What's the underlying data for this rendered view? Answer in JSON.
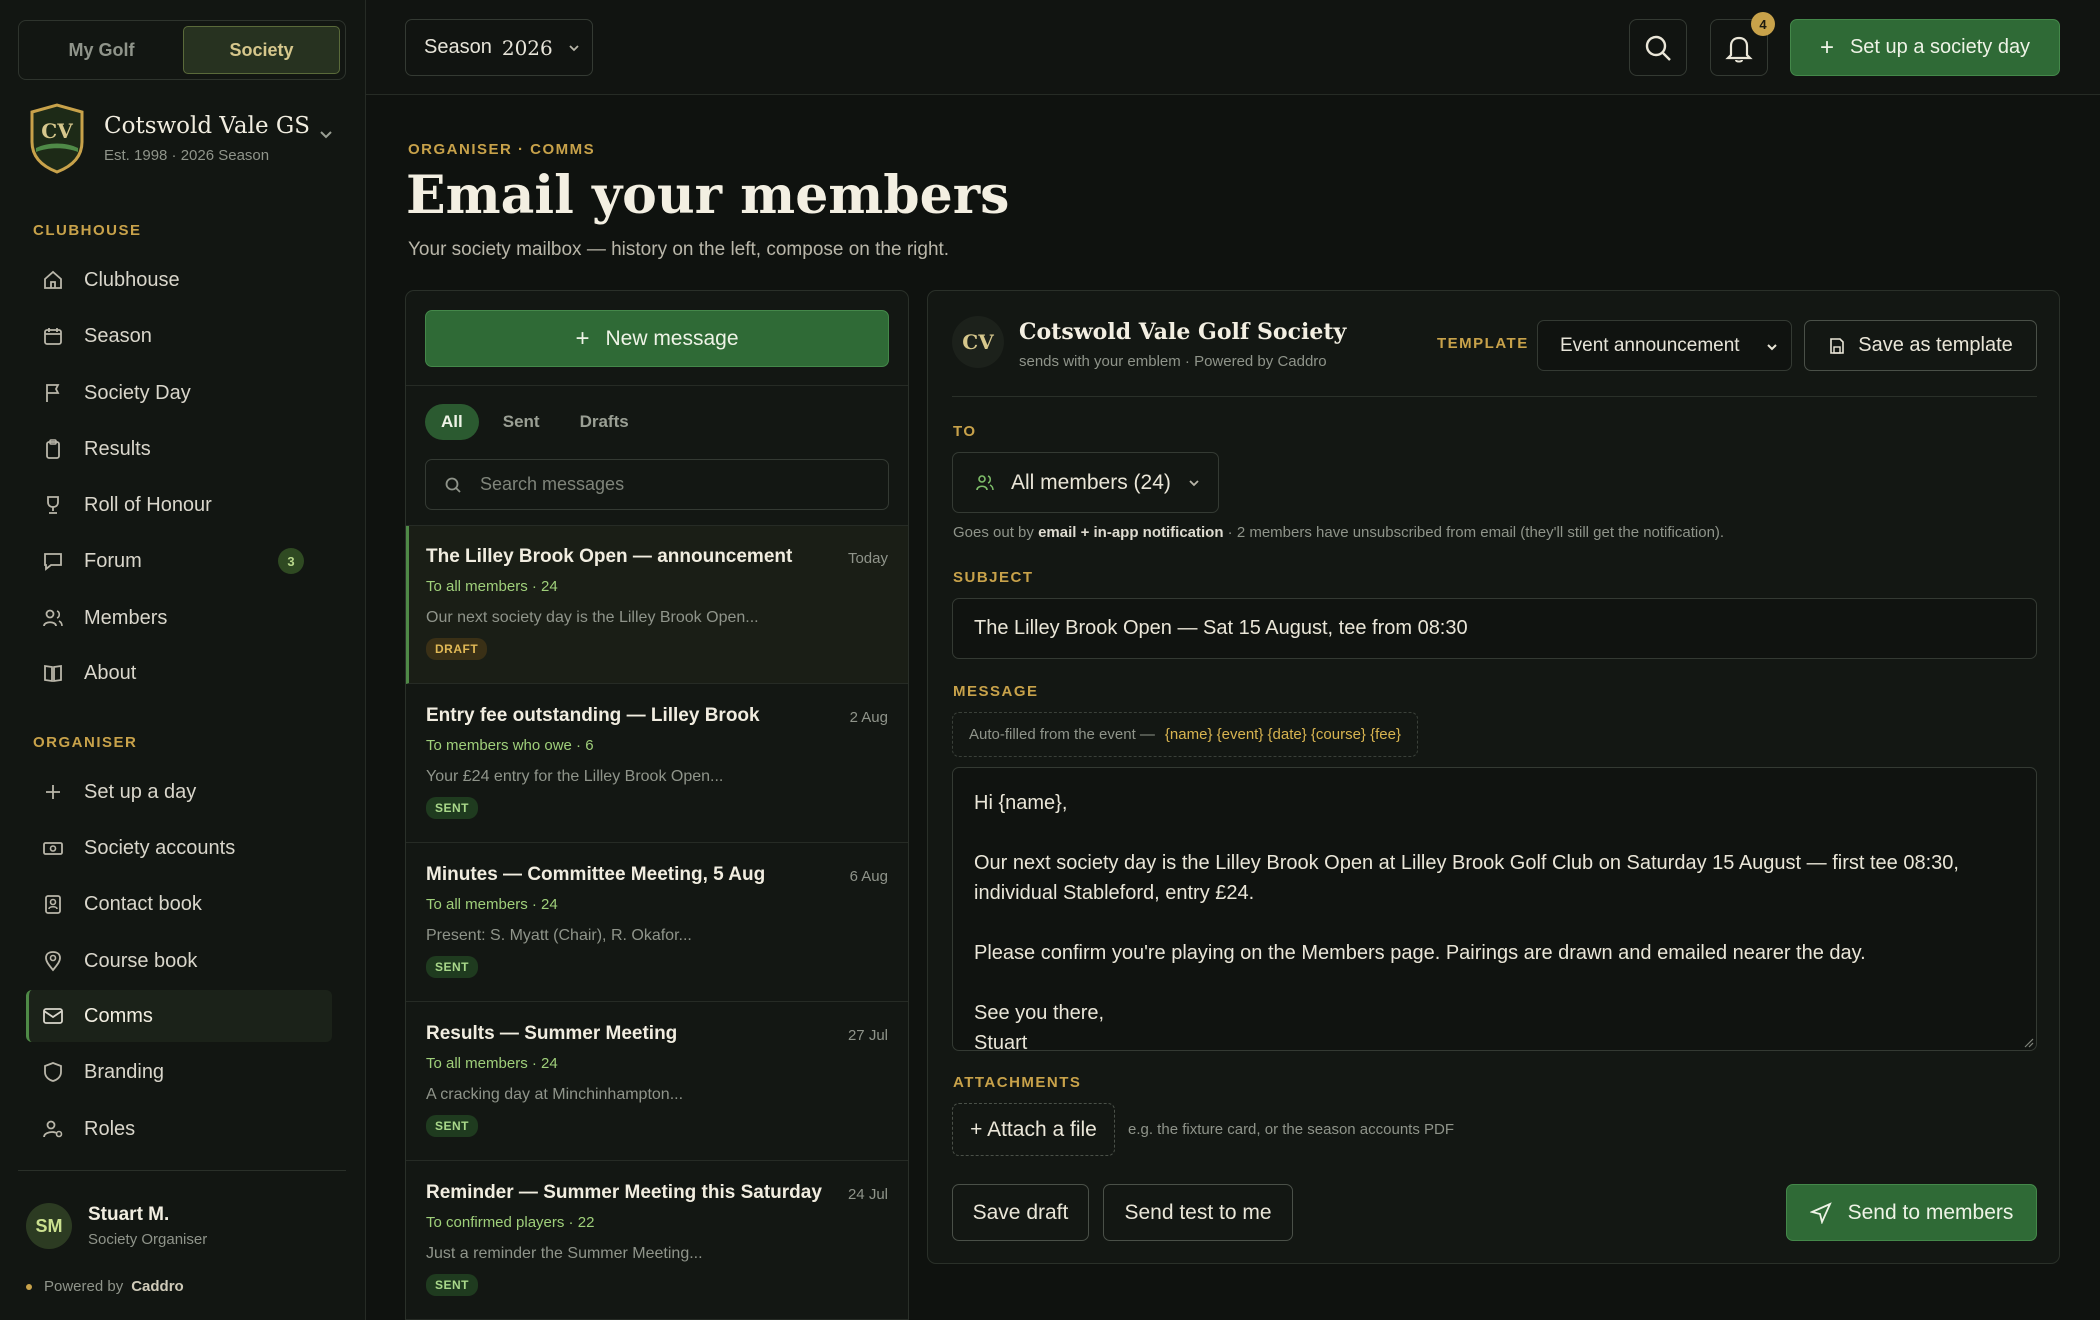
{
  "sidebar": {
    "mode_tabs": [
      "My Golf",
      "Society"
    ],
    "club": {
      "initials": "CV",
      "name": "Cotswold Vale GS",
      "subtitle": "Est. 1998 · 2026 Season"
    },
    "sections": {
      "clubhouse": "CLUBHOUSE",
      "organiser": "ORGANISER"
    },
    "clubhouse_items": [
      {
        "label": "Clubhouse",
        "icon": "home-icon"
      },
      {
        "label": "Season",
        "icon": "calendar-icon"
      },
      {
        "label": "Society Day",
        "icon": "flag-icon"
      },
      {
        "label": "Results",
        "icon": "clipboard-icon"
      },
      {
        "label": "Roll of Honour",
        "icon": "trophy-icon"
      },
      {
        "label": "Forum",
        "icon": "chat-icon",
        "badge": "3"
      },
      {
        "label": "Members",
        "icon": "people-icon"
      },
      {
        "label": "About",
        "icon": "book-icon"
      }
    ],
    "organiser_items": [
      {
        "label": "Set up a day",
        "icon": "plus-icon"
      },
      {
        "label": "Society accounts",
        "icon": "banknote-icon"
      },
      {
        "label": "Contact book",
        "icon": "contact-card-icon"
      },
      {
        "label": "Course book",
        "icon": "map-pin-icon"
      },
      {
        "label": "Comms",
        "icon": "mail-icon",
        "active": true
      },
      {
        "label": "Branding",
        "icon": "shield-icon"
      },
      {
        "label": "Roles",
        "icon": "user-gear-icon"
      }
    ],
    "user": {
      "initials": "SM",
      "name": "Stuart M.",
      "role": "Society Organiser"
    },
    "powered_label": "Powered by",
    "powered_brand": "Caddro"
  },
  "topbar": {
    "season_label": "Season",
    "season_year": "2026",
    "notifications_count": "4",
    "setup_button": "Set up a society day"
  },
  "header": {
    "eyebrow": "ORGANISER · COMMS",
    "title": "Email your members",
    "subtitle": "Your society mailbox — history on the left, compose on the right."
  },
  "mailbox": {
    "new_message": "New message",
    "filters": [
      "All",
      "Sent",
      "Drafts"
    ],
    "search_placeholder": "Search messages",
    "messages": [
      {
        "title": "The Lilley Brook Open — announcement",
        "date": "Today",
        "to": "To all members · 24",
        "preview": "Our next society day is the Lilley Brook Open...",
        "status": "DRAFT"
      },
      {
        "title": "Entry fee outstanding — Lilley Brook",
        "date": "2 Aug",
        "to": "To members who owe · 6",
        "preview": "Your £24 entry for the Lilley Brook Open...",
        "status": "SENT"
      },
      {
        "title": "Minutes — Committee Meeting, 5 Aug",
        "date": "6 Aug",
        "to": "To all members · 24",
        "preview": "Present: S. Myatt (Chair), R. Okafor...",
        "status": "SENT"
      },
      {
        "title": "Results — Summer Meeting",
        "date": "27 Jul",
        "to": "To all members · 24",
        "preview": "A cracking day at Minchinhampton...",
        "status": "SENT"
      },
      {
        "title": "Reminder — Summer Meeting this Saturday",
        "date": "24 Jul",
        "to": "To confirmed players · 22",
        "preview": "Just a reminder the Summer Meeting...",
        "status": "SENT"
      }
    ]
  },
  "compose": {
    "emblem": "CV",
    "sender_name": "Cotswold Vale Golf Society",
    "sender_sub": "sends with your emblem · Powered by Caddro",
    "template_label": "TEMPLATE",
    "template_value": "Event announcement",
    "save_template": "Save as template",
    "to_label": "TO",
    "to_value": "All members (24)",
    "delivery_prefix": "Goes out by",
    "delivery_bold": "email + in-app notification",
    "delivery_suffix": " · 2 members have unsubscribed from email (they'll still get the notification).",
    "subject_label": "SUBJECT",
    "subject_value": "The Lilley Brook Open — Sat 15 August, tee from 08:30",
    "message_label": "MESSAGE",
    "merge_prefix": "Auto-filled from the event —",
    "merge_tokens": "{name} {event} {date} {course} {fee}",
    "message_lines": [
      "Hi {name},",
      "",
      "Our next society day is the Lilley Brook Open at Lilley Brook Golf Club on Saturday 15 August — first tee 08:30, individual Stableford, entry £24.",
      "",
      "Please confirm you're playing on the Members page. Pairings are drawn and emailed nearer the day.",
      "",
      "See you there,",
      "Stuart"
    ],
    "attachments_label": "ATTACHMENTS",
    "attach_button": "+ Attach a file",
    "attach_hint": "e.g. the fixture card, or the season accounts PDF",
    "save_draft": "Save draft",
    "send_test": "Send test to me",
    "send": "Send to members"
  },
  "colors": {
    "accent_gold": "#c8a24a",
    "primary_green": "#2f6a36",
    "background": "#0f120f"
  }
}
